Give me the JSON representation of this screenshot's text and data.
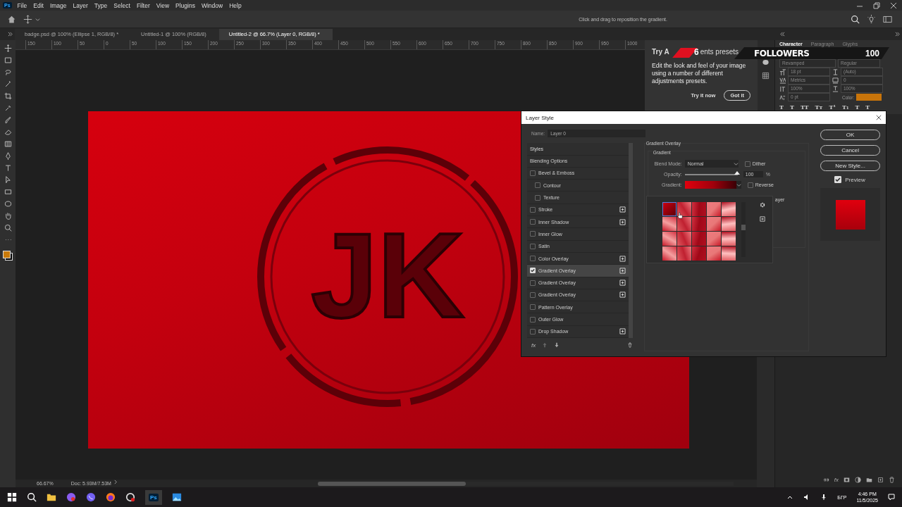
{
  "menu_bar": {
    "app_badge": "Ps",
    "items": [
      "File",
      "Edit",
      "Image",
      "Layer",
      "Type",
      "Select",
      "Filter",
      "View",
      "Plugins",
      "Window",
      "Help"
    ]
  },
  "options_bar": {
    "hint": "Click and drag to reposition the gradient."
  },
  "document_tabs": [
    {
      "label": "badge.psd @ 100% (Ellipse 1, RGB/8) *",
      "selected": false
    },
    {
      "label": "Untitled-1 @ 100% (RGB/8)",
      "selected": false
    },
    {
      "label": "Untitled-2 @ 66.7% (Layer 0, RGB/8) *",
      "selected": true
    }
  ],
  "ruler": [
    "150",
    "100",
    "50",
    "0",
    "50",
    "100",
    "150",
    "200",
    "250",
    "300",
    "350",
    "400",
    "450",
    "500",
    "550",
    "600",
    "650",
    "700",
    "750",
    "800",
    "850",
    "900",
    "950",
    "1000"
  ],
  "canvas": {
    "letters": "JK"
  },
  "tip": {
    "title_start": "Try A",
    "title_end": "ents presets",
    "body": "Edit the look and feel of your image using a number of different adjustments presets.",
    "link": "Try it now",
    "button": "Got it"
  },
  "stream_overlay": {
    "count": "6",
    "label": "FOLLOWERS",
    "goal": "100"
  },
  "character_panel": {
    "tabs": [
      {
        "label": "Character",
        "selected": true
      },
      {
        "label": "Paragraph",
        "selected": false
      },
      {
        "label": "Glyphs",
        "selected": false
      }
    ],
    "font": "Revamped",
    "style": "Regular",
    "size": "18 pt",
    "leading": "(Auto)",
    "kerning": "Metrics",
    "tracking": "0",
    "vertical_scale": "100%",
    "horizontal_scale": "100%",
    "baseline": "0 pt",
    "color_label": "Color:",
    "type_buttons": [
      "T",
      "T",
      "TT",
      "Tт",
      "T¹",
      "T₁",
      "T",
      "T"
    ]
  },
  "layer_style": {
    "title": "Layer Style",
    "name_label": "Name:",
    "name": "Layer 0",
    "styles": [
      {
        "kind": "header",
        "label": "Styles",
        "selected": false
      },
      {
        "kind": "plain",
        "label": "Blending Options",
        "selected": false
      },
      {
        "kind": "check",
        "label": "Bevel & Emboss",
        "checked": false,
        "addable": false,
        "selected": false,
        "children": [
          {
            "kind": "check",
            "label": "Contour",
            "checked": false,
            "addable": false,
            "selected": false
          },
          {
            "kind": "check",
            "label": "Texture",
            "checked": false,
            "addable": false,
            "selected": false
          }
        ]
      },
      {
        "kind": "check",
        "label": "Stroke",
        "checked": false,
        "addable": true,
        "selected": false
      },
      {
        "kind": "check",
        "label": "Inner Shadow",
        "checked": false,
        "addable": true,
        "selected": false
      },
      {
        "kind": "check",
        "label": "Inner Glow",
        "checked": false,
        "addable": false,
        "selected": false
      },
      {
        "kind": "check",
        "label": "Satin",
        "checked": false,
        "addable": false,
        "selected": false
      },
      {
        "kind": "check",
        "label": "Color Overlay",
        "checked": false,
        "addable": true,
        "selected": false
      },
      {
        "kind": "check",
        "label": "Gradient Overlay",
        "checked": true,
        "addable": true,
        "selected": true
      },
      {
        "kind": "check",
        "label": "Gradient Overlay",
        "checked": false,
        "addable": true,
        "selected": false
      },
      {
        "kind": "check",
        "label": "Gradient Overlay",
        "checked": false,
        "addable": true,
        "selected": false
      },
      {
        "kind": "check",
        "label": "Pattern Overlay",
        "checked": false,
        "addable": false,
        "selected": false
      },
      {
        "kind": "check",
        "label": "Outer Glow",
        "checked": false,
        "addable": false,
        "selected": false
      },
      {
        "kind": "check",
        "label": "Drop Shadow",
        "checked": false,
        "addable": true,
        "selected": false
      }
    ],
    "fx_label": "fx",
    "section_title": "Gradient Overlay",
    "group_title": "Gradient",
    "blend_label": "Blend Mode:",
    "blend_mode": "Normal",
    "dither": {
      "label": "Dither",
      "checked": false
    },
    "opacity_label": "Opacity:",
    "opacity": {
      "level": 1,
      "value": "100",
      "unit": "%"
    },
    "gradient_label": "Gradient:",
    "reverse": {
      "label": "Reverse",
      "checked": false
    },
    "hidden_label": "ayer",
    "swatches": [
      {
        "selected": true
      },
      {
        "selected": false
      },
      {
        "selected": false
      },
      {
        "selected": false
      },
      {
        "selected": false
      },
      {
        "selected": false
      },
      {
        "selected": false
      },
      {
        "selected": false
      },
      {
        "selected": false
      },
      {
        "selected": false
      },
      {
        "selected": false
      },
      {
        "selected": false
      },
      {
        "selected": false
      },
      {
        "selected": false
      },
      {
        "selected": false
      },
      {
        "selected": false
      },
      {
        "selected": false
      },
      {
        "selected": false
      },
      {
        "selected": false
      },
      {
        "selected": false
      }
    ],
    "buttons": [
      "OK",
      "Cancel",
      "New Style..."
    ],
    "preview": {
      "label": "Preview",
      "checked": true
    }
  },
  "layers_panel": {
    "fx_label": "fx"
  },
  "status_bar": {
    "zoom": "66.67%",
    "doc": "Doc: 5.93M/7.53M"
  },
  "taskbar": {
    "app_badge": "Ps",
    "language": "БГР",
    "time": "4:46 PM",
    "date": "11/5/2025"
  }
}
